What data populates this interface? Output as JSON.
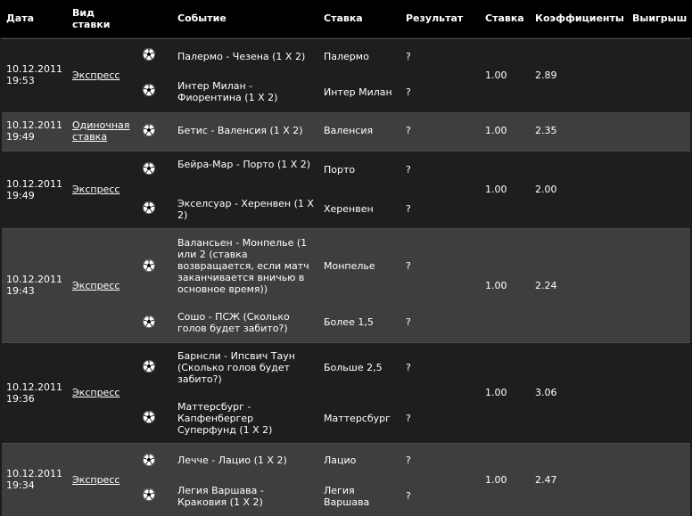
{
  "header": {
    "date": "Дата",
    "type_line1": "Вид",
    "type_line2": "ставки",
    "event": "Событие",
    "bet": "Ставка",
    "result": "Результат",
    "stake": "Ставка",
    "coef": "Коэффициенты",
    "win": "Выигрыш"
  },
  "bets": [
    {
      "date": "10.12.2011",
      "time": "19:53",
      "type": "Экспресс",
      "stake": "1.00",
      "coef": "2.89",
      "events": [
        {
          "event": "Палермо - Чезена (1 X 2)",
          "bet": "Палермо",
          "result": "?"
        },
        {
          "event": "Интер Милан - Фиорентина (1 X 2)",
          "bet": "Интер Милан",
          "result": "?"
        }
      ]
    },
    {
      "date": "10.12.2011",
      "time": "19:49",
      "type_line1": "Одиночная",
      "type_line2": "ставка",
      "stake": "1.00",
      "coef": "2.35",
      "events": [
        {
          "event": "Бетис - Валенсия (1 X 2)",
          "bet": "Валенсия",
          "result": "?"
        }
      ]
    },
    {
      "date": "10.12.2011",
      "time": "19:49",
      "type": "Экспресс",
      "stake": "1.00",
      "coef": "2.00",
      "events": [
        {
          "event": "Бейра-Мар - Порто (1 X 2)",
          "bet": "Порто",
          "result": "?"
        },
        {
          "event": "Экселсуар - Херенвен (1 X 2)",
          "bet": "Херенвен",
          "result": "?"
        }
      ]
    },
    {
      "date": "10.12.2011",
      "time": "19:43",
      "type": "Экспресс",
      "stake": "1.00",
      "coef": "2.24",
      "events": [
        {
          "event": "Валансьен - Монпелье (1 или 2 (ставка возвращается, если матч заканчивается вничью в основное время))",
          "bet": "Монпелье",
          "result": "?"
        },
        {
          "event": "Сошо - ПСЖ (Сколько голов будет забито?)",
          "bet": "Более 1,5",
          "result": "?"
        }
      ]
    },
    {
      "date": "10.12.2011",
      "time": "19:36",
      "type": "Экспресс",
      "stake": "1.00",
      "coef": "3.06",
      "events": [
        {
          "event": "Барнсли - Ипсвич Таун (Сколько голов будет забито?)",
          "bet": "Больше 2,5",
          "result": "?"
        },
        {
          "event": "Маттерсбург - Капфенбергер Суперфунд (1 X 2)",
          "bet": "Маттерсбург",
          "result": "?"
        }
      ]
    },
    {
      "date": "10.12.2011",
      "time": "19:34",
      "type": "Экспресс",
      "stake": "1.00",
      "coef": "2.47",
      "events": [
        {
          "event": "Лечче - Лацио (1 X 2)",
          "bet": "Лацио",
          "result": "?"
        },
        {
          "event": "Легия Варшава - Краковия (1 X 2)",
          "bet": "Легия Варшава",
          "result": "?"
        }
      ]
    }
  ]
}
